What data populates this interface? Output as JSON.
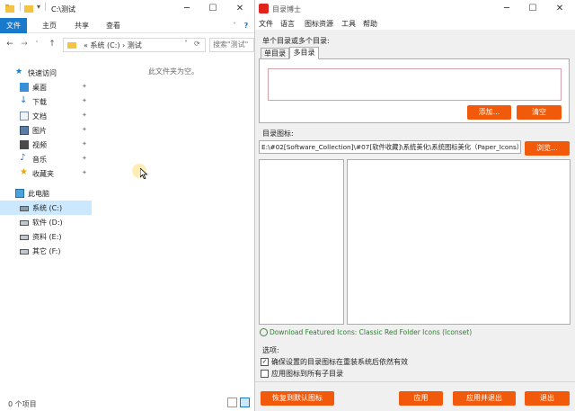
{
  "explorer": {
    "title": "C:\\测试",
    "ribbon_tabs": [
      "文件",
      "主页",
      "共享",
      "查看"
    ],
    "address_path": "« 系统 (C:) › 测试",
    "search_placeholder": "搜索\"测试\"",
    "empty_message": "此文件夹为空。",
    "status_text": "0 个项目",
    "nav_items": [
      {
        "label": "快速访问",
        "icon": "star-icon"
      },
      {
        "label": "桌面",
        "icon": "desktop-icon"
      },
      {
        "label": "下载",
        "icon": "download-icon"
      },
      {
        "label": "文档",
        "icon": "document-icon"
      },
      {
        "label": "图片",
        "icon": "picture-icon"
      },
      {
        "label": "视频",
        "icon": "video-icon"
      },
      {
        "label": "音乐",
        "icon": "music-icon"
      },
      {
        "label": "收藏夹",
        "icon": "favorites-icon"
      },
      {
        "label": "此电脑",
        "icon": "computer-icon"
      },
      {
        "label": "系统 (C:)",
        "icon": "drive-icon"
      },
      {
        "label": "软件 (D:)",
        "icon": "drive-icon"
      },
      {
        "label": "资料 (E:)",
        "icon": "drive-icon"
      },
      {
        "label": "其它 (F:)",
        "icon": "drive-icon"
      }
    ]
  },
  "marker": {
    "title": "目录博士",
    "menu": [
      "文件",
      "语言",
      "图标资源",
      "工具",
      "帮助"
    ],
    "section_label": "单个目录或多个目录:",
    "tabs": [
      "单目录",
      "多目录"
    ],
    "add_button": "添加...",
    "clear_button": "清空",
    "icon_label": "目录图标:",
    "icon_path": "E:\\#02[Software_Collection]\\#07[软件收藏]\\系统美化\\系统图标美化（Paper_Icons）",
    "browse_button": "浏览...",
    "download_link": "Download Featured Icons: Classic Red Folder Icons (Iconset)",
    "options_label": "选项:",
    "option1": "确保设置的目录图标在重装系统后依然有效",
    "option2": "应用图标到所有子目录",
    "restore_button": "恢复到默认图标",
    "apply_button": "应用",
    "apply_exit_button": "应用并退出",
    "exit_button": "退出",
    "colors": {
      "accent": "#f05a0a",
      "brand": "#e1241c",
      "link": "#2e7d32"
    }
  }
}
